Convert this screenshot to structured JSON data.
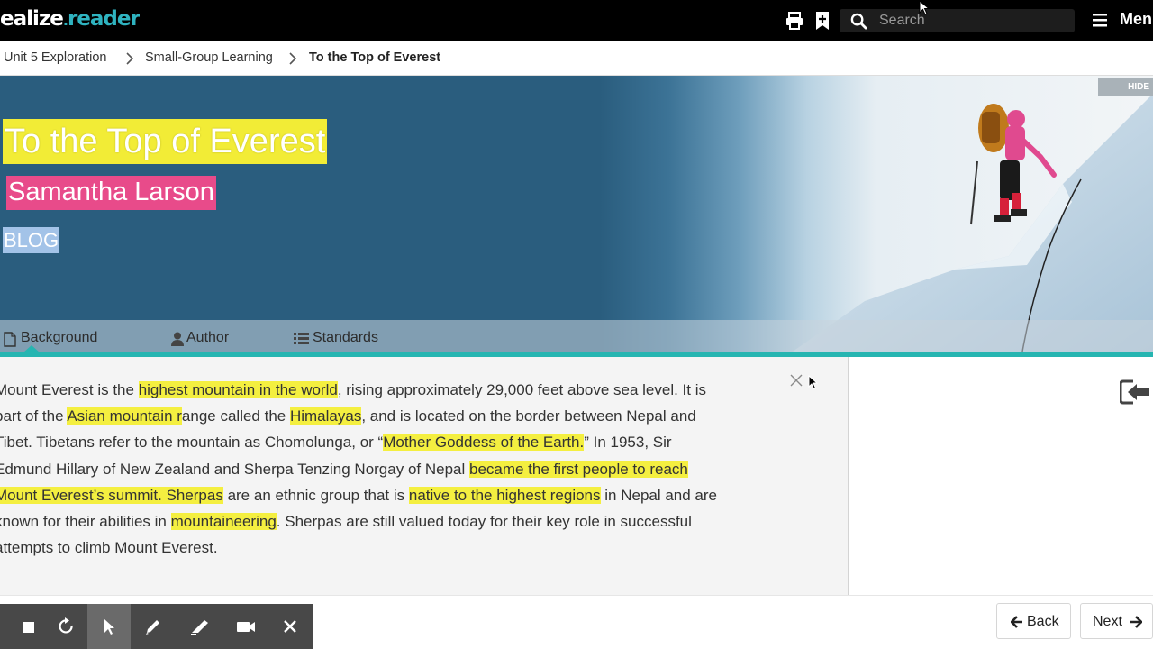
{
  "app": {
    "logo_part1": "ealize",
    "logo_part2": "reader",
    "logo_dot": "."
  },
  "header": {
    "search_placeholder": "Search",
    "menu_label": "Men",
    "icons": [
      "print-icon",
      "bookmark-add-icon",
      "search-icon",
      "hamburger-menu-icon"
    ]
  },
  "breadcrumb": {
    "items": [
      "Unit 5 Exploration",
      "Small-Group Learning",
      "To the Top of Everest"
    ]
  },
  "hero": {
    "hide_label": "HIDE",
    "title": "To the Top of Everest",
    "author": "Samantha Larson",
    "genre": "BLOG",
    "highlight_colors": {
      "title": "#f2ec36",
      "author": "#e84b8a",
      "genre": "#a3c3e8"
    }
  },
  "tabs": [
    {
      "label": "Background",
      "icon": "document-icon"
    },
    {
      "label": "Author",
      "icon": "user-icon"
    },
    {
      "label": "Standards",
      "icon": "list-icon"
    }
  ],
  "background_text": {
    "lines": [
      [
        {
          "t": "Mount Everest is the "
        },
        {
          "t": "highest mountain in the world",
          "hl": true
        },
        {
          "t": ", rising approximately 29,000 feet above sea level. It is"
        }
      ],
      [
        {
          "t": "part of the "
        },
        {
          "t": "Asian mountain r",
          "hl": true
        },
        {
          "t": "ange called the "
        },
        {
          "t": "Himalayas",
          "hl": true
        },
        {
          "t": ", and is located on the border between Nepal and"
        }
      ],
      [
        {
          "t": "Tibet. Tibetans refer to the mountain as Chomolunga, or “"
        },
        {
          "t": "Mother Goddess of the Earth.",
          "hl": true
        },
        {
          "t": "” In 1953, Sir"
        }
      ],
      [
        {
          "t": "Edmund Hillary of New Zealand and Sherpa Tenzing Norgay of Nepal "
        },
        {
          "t": "became the first people to reach",
          "hl": true
        }
      ],
      [
        {
          "t": "Mount Everest’s summit. Sherpas",
          "hl": true
        },
        {
          "t": " are an ethnic group that is "
        },
        {
          "t": "native to the highest regions",
          "hl": true
        },
        {
          "t": " in Nepal and are"
        }
      ],
      [
        {
          "t": "known for their abilities in "
        },
        {
          "t": "mountaineering",
          "hl": true
        },
        {
          "t": ". Sherpas are still valued today for their key role in successful"
        }
      ],
      [
        {
          "t": "attempts to climb Mount Everest."
        }
      ]
    ],
    "highlight_color": "#f4ef40"
  },
  "annotation_toolbar": {
    "tools": [
      "stop-icon",
      "undo-icon",
      "pointer-icon",
      "pencil-icon",
      "highlighter-icon",
      "video-camera-icon",
      "close-icon"
    ],
    "active_tool": "pointer-icon"
  },
  "navigation": {
    "back_label": "Back",
    "next_label": "Next"
  }
}
